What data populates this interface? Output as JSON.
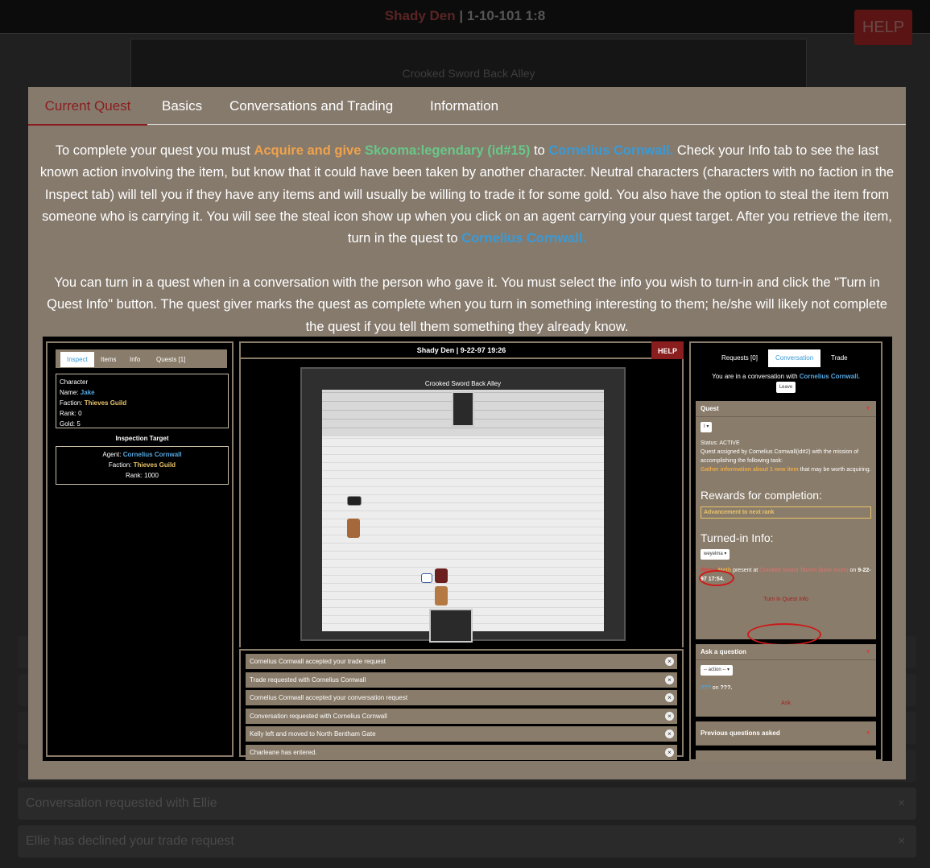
{
  "background": {
    "title_location": "Shady Den",
    "title_time": "| 1-10-101 1:8",
    "help_label": "HELP",
    "map_label": "Crooked Sword Back Alley",
    "log_rows": [
      {
        "text": "",
        "close": "×"
      },
      {
        "text": "",
        "close": "×"
      },
      {
        "text": "",
        "close": "×"
      },
      {
        "text": "",
        "close": "×"
      },
      {
        "text": "Conversation requested with Ellie",
        "close": "×"
      },
      {
        "text": "Ellie has declined your trade request",
        "close": "×"
      }
    ]
  },
  "modal": {
    "tabs": [
      {
        "label": "Current Quest"
      },
      {
        "label": "Basics"
      },
      {
        "label": "Conversations and Trading"
      },
      {
        "label": "Information"
      }
    ],
    "desc": {
      "p1_a": "To complete your quest you must ",
      "action": "Acquire and give",
      "item": "Skooma:legendary (id#15)",
      "p1_b": " to ",
      "target": "Cornelius Cornwall.",
      "p1_c": " Check your Info tab to see the last known action involving the item, but know that it could have been taken by another character. Neutral characters (characters with no faction in the Inspect tab) will tell you if they have any items and will usually be willing to trade it for some gold. You also have the option to steal the item from someone who is carrying it. You will see the steal icon show up when you click on an agent carrying your quest target. After you retrieve the item, turn in the quest to ",
      "target2": "Cornelius Cornwall.",
      "p2": "You can turn in a quest when in a conversation with the person who gave it. You must select the info you wish to turn-in and click the \"Turn in Quest Info\" button. The quest giver marks the quest as complete when you turn in something interesting to them; he/she will likely not complete the quest if you tell them something they already know."
    }
  },
  "example": {
    "left_tabs": [
      "Inspect",
      "Items",
      "Info",
      "Quests [1]"
    ],
    "character": {
      "heading": "Character",
      "name_label": "Name: ",
      "name": "Jake",
      "faction_label": "Faction: ",
      "faction": "Thieves Guild",
      "rank": "Rank: 0",
      "gold": "Gold: 5"
    },
    "inspection": {
      "heading": "Inspection Target",
      "agent_label": "Agent: ",
      "agent": "Cornelius Cornwall",
      "faction_label": "Faction: ",
      "faction": "Thieves Guild",
      "rank": "Rank: 1000"
    },
    "mid_title": "Shady Den | 9-22-97 19:26",
    "help_label": "HELP",
    "room_label": "Crooked Sword Back Alley",
    "log": [
      "Cornelius Cornwall accepted your trade request",
      "Trade requested with Cornelius Cornwall",
      "Cornelius Cornwall accepted your conversation request",
      "Conversation requested with Cornelius Cornwall",
      "Kelly left and moved to North Bentham Gate",
      "Charleane has entered."
    ],
    "log_close": "×",
    "right_tabs": [
      "Requests [0]",
      "Conversation",
      "Trade"
    ],
    "conv_status_a": "You are in a conversation with ",
    "conv_partner": "Cornelius Cornwall.",
    "leave_label": "Leave",
    "quest": {
      "heading": "Quest",
      "select": "I",
      "status": "Status: ACTIVE",
      "assigned": "Quest assigned by Cornelius Cornwall(id#2) with the mission of accomplishing the following task:",
      "task": "Gather information about 1 new item",
      "task_tail": " that may be worth acquiring.",
      "rewards_heading": "Rewards for completion:",
      "reward": "Advancement to next rank",
      "turned_heading": "Turned-in Info:",
      "turned_select": "weyelma",
      "info_a": "Illegal",
      "info_b": "Meth",
      "info_c": " present at ",
      "info_place": "Crooked Sword Tavern (back room)",
      "info_d": " on ",
      "info_date": "9-22-97 17:54.",
      "turn_in_label": "Turn in Quest Info"
    },
    "ask": {
      "heading": "Ask a question",
      "select": "-- action --",
      "q_a": "???",
      "q_b": " on ",
      "q_c": "???.",
      "ask_label": "Ask"
    },
    "prev": {
      "heading": "Previous questions asked"
    }
  },
  "colors": {
    "modal_bg": "#867a6d",
    "active_tab": "#8a1d1d",
    "action": "#f0a24b",
    "item": "#69c788",
    "person": "#3a9ad6"
  }
}
